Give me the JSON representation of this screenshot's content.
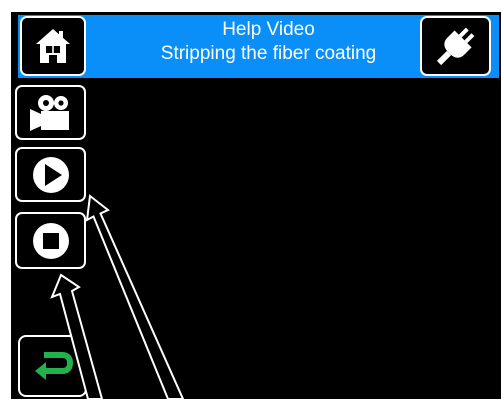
{
  "header": {
    "title_line1": "Help Video",
    "title_line2": "Stripping the fiber coating",
    "background_color": "#0a8ef7"
  },
  "buttons": {
    "home": {
      "icon": "home-icon"
    },
    "power": {
      "icon": "plug-icon"
    },
    "camera": {
      "icon": "video-camera-icon"
    },
    "play": {
      "icon": "play-icon"
    },
    "stop": {
      "icon": "stop-icon"
    },
    "back": {
      "icon": "return-arrow-icon",
      "color": "#22b14c"
    }
  },
  "colors": {
    "screen_background": "#000000",
    "button_border": "#ffffff",
    "callout_lines": "#ffffff"
  }
}
